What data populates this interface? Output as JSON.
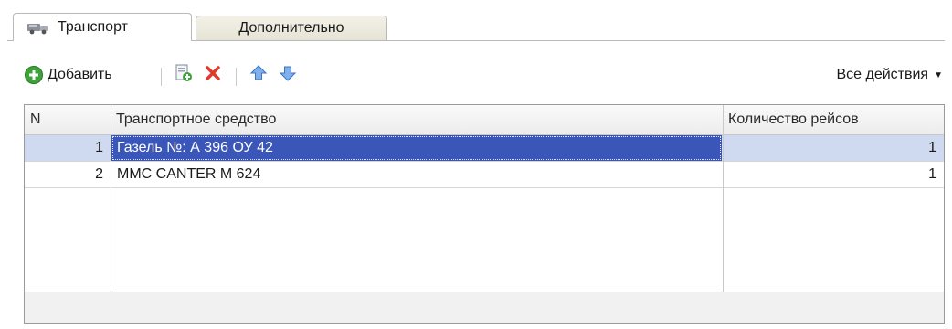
{
  "tabs": [
    {
      "label": "Транспорт",
      "icon": "truck-icon",
      "active": true
    },
    {
      "label": "Дополнительно",
      "active": false
    }
  ],
  "toolbar": {
    "add_label": "Добавить",
    "all_actions_label": "Все действия",
    "icons": [
      "add-icon",
      "copy-icon",
      "delete-icon",
      "move-up-icon",
      "move-down-icon"
    ]
  },
  "table": {
    "columns": [
      "N",
      "Транспортное средство",
      "Количество рейсов"
    ],
    "rows": [
      {
        "n": "1",
        "vehicle": "Газель №: А 396 ОУ 42",
        "trips": "1"
      },
      {
        "n": "2",
        "vehicle": "MMC CANTER M 624",
        "trips": "1"
      }
    ]
  },
  "colors": {
    "selected_row": "#cfdaf0",
    "focus_cell": "#3a56b8",
    "add_green": "#3ea23a",
    "delete_red": "#e03a2a",
    "arrow_blue": "#4a86d8"
  }
}
